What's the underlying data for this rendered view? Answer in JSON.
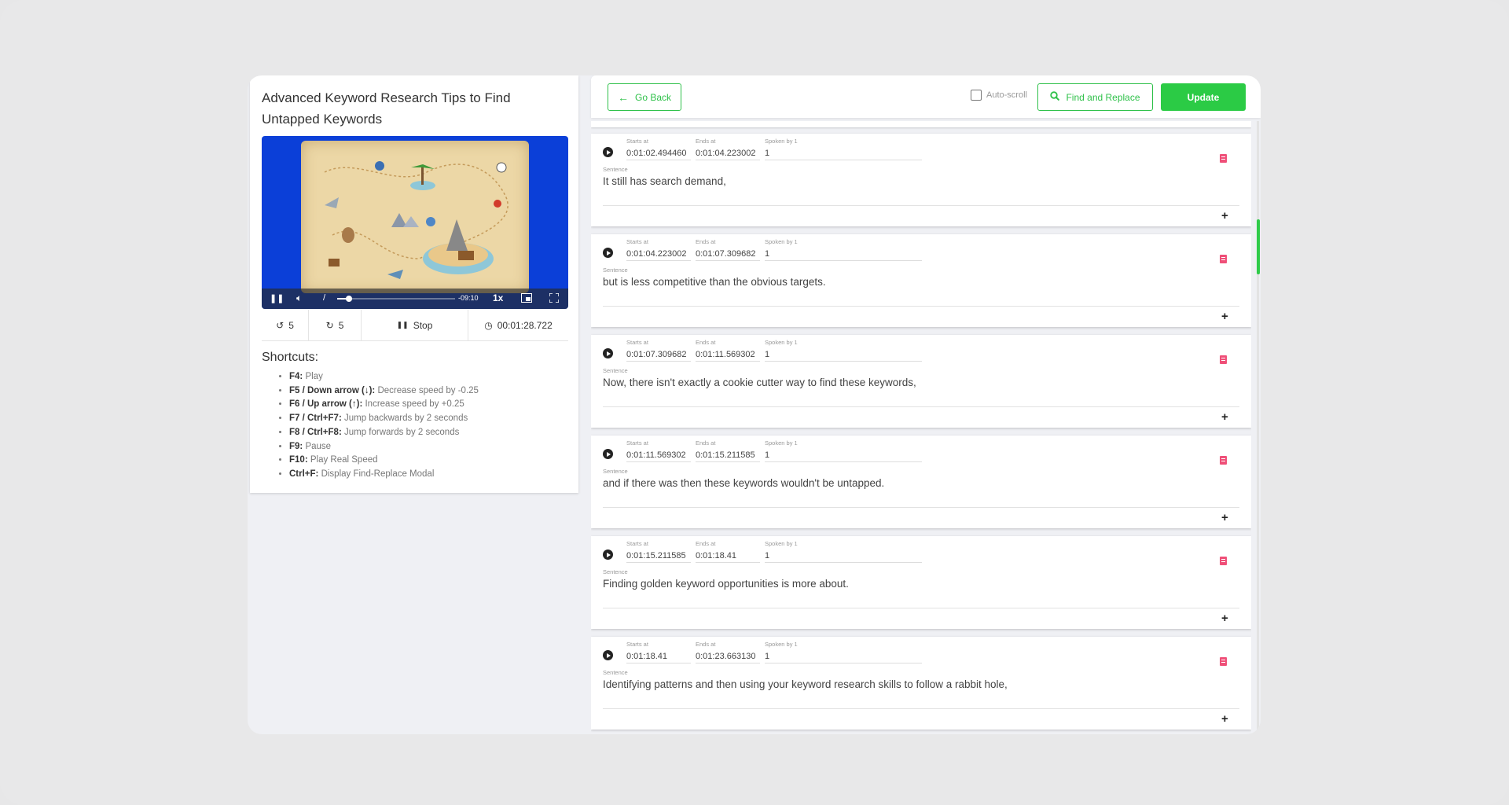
{
  "video": {
    "title": "Advanced Keyword Research Tips to Find Untapped Keywords",
    "progress_fraction": 0.1,
    "remaining_time": "-09:10",
    "speed": "1x",
    "rewind_seconds": "5",
    "forward_seconds": "5",
    "stop_label": "Stop",
    "current_time": "00:01:28.722"
  },
  "shortcuts": {
    "title": "Shortcuts:",
    "items": [
      {
        "key": "F4:",
        "desc": " Play"
      },
      {
        "key": "F5 / Down arrow (↓):",
        "desc": " Decrease speed by -0.25"
      },
      {
        "key": "F6 / Up arrow (↑):",
        "desc": " Increase speed by +0.25"
      },
      {
        "key": "F7 / Ctrl+F7:",
        "desc": " Jump backwards by 2 seconds"
      },
      {
        "key": "F8 / Ctrl+F8:",
        "desc": " Jump forwards by 2 seconds"
      },
      {
        "key": "F9:",
        "desc": " Pause"
      },
      {
        "key": "F10:",
        "desc": " Play Real Speed"
      },
      {
        "key": "Ctrl+F:",
        "desc": " Display Find-Replace Modal"
      }
    ]
  },
  "toolbar": {
    "go_back": "Go Back",
    "autoscroll": "Auto-scroll",
    "find_replace": "Find and Replace",
    "update": "Update"
  },
  "labels": {
    "starts": "Starts at",
    "ends": "Ends at",
    "spoken": "Spoken by 1",
    "sentence": "Sentence"
  },
  "segments": [
    {
      "start": "0:01:02.494460",
      "end": "0:01:04.223002",
      "speaker": "1",
      "sentence": "It still has search demand,"
    },
    {
      "start": "0:01:04.223002",
      "end": "0:01:07.309682",
      "speaker": "1",
      "sentence": "but is less competitive than the obvious targets."
    },
    {
      "start": "0:01:07.309682",
      "end": "0:01:11.569302",
      "speaker": "1",
      "sentence": "Now, there isn't exactly a cookie cutter way to find these keywords,"
    },
    {
      "start": "0:01:11.569302",
      "end": "0:01:15.211585",
      "speaker": "1",
      "sentence": "and if there was then these keywords wouldn't be untapped."
    },
    {
      "start": "0:01:15.211585",
      "end": "0:01:18.41",
      "speaker": "1",
      "sentence": "Finding golden keyword opportunities is more about."
    },
    {
      "start": "0:01:18.41",
      "end": "0:01:23.663130",
      "speaker": "1",
      "sentence": "Identifying patterns and then using your keyword research skills to follow a rabbit hole,"
    }
  ],
  "colors": {
    "accent": "#2bcb45",
    "delete": "#ef4f78",
    "video_bg": "#0b3fd8"
  }
}
